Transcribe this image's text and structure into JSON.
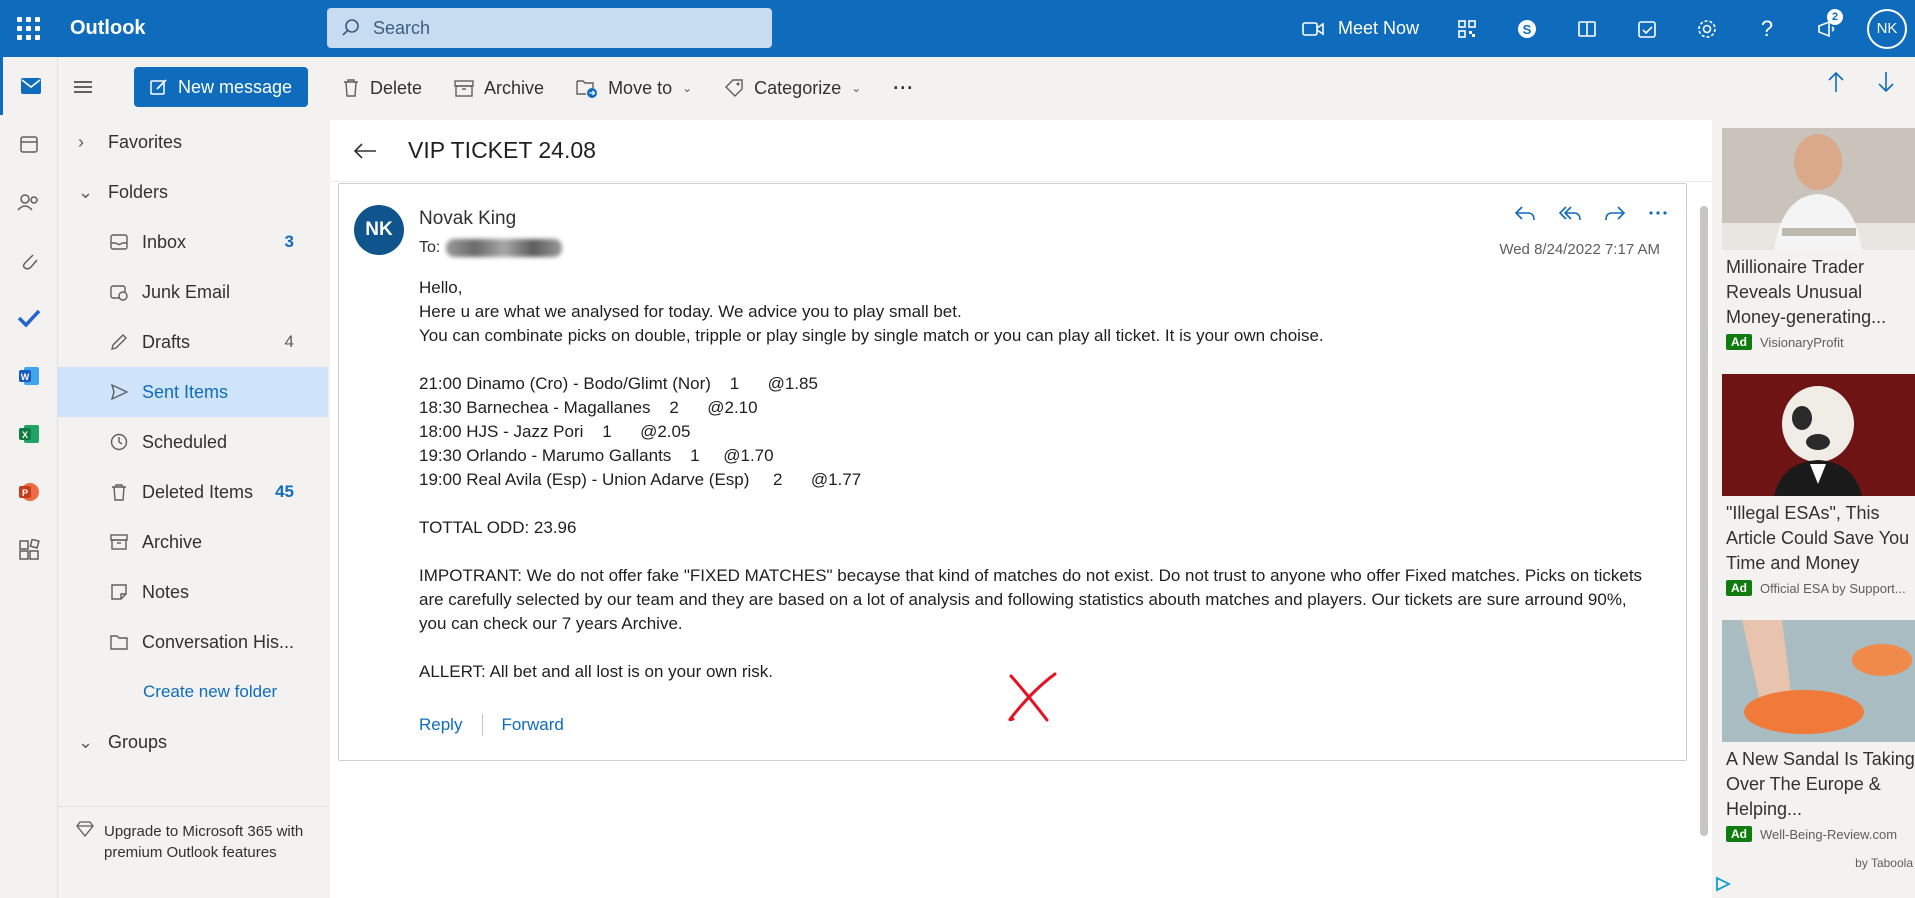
{
  "app": {
    "name": "Outlook"
  },
  "search": {
    "placeholder": "Search"
  },
  "topbar": {
    "meet_now": "Meet Now",
    "notifications_count": "2",
    "user_initials": "NK"
  },
  "toolbar": {
    "new_message": "New message",
    "delete": "Delete",
    "archive": "Archive",
    "move_to": "Move to",
    "categorize": "Categorize",
    "more": "···"
  },
  "folders": {
    "favorites": "Favorites",
    "folders_header": "Folders",
    "items": [
      {
        "label": "Inbox",
        "count": "3"
      },
      {
        "label": "Junk Email",
        "count": ""
      },
      {
        "label": "Drafts",
        "count": "4"
      },
      {
        "label": "Sent Items",
        "count": ""
      },
      {
        "label": "Scheduled",
        "count": ""
      },
      {
        "label": "Deleted Items",
        "count": "45"
      },
      {
        "label": "Archive",
        "count": ""
      },
      {
        "label": "Notes",
        "count": ""
      },
      {
        "label": "Conversation His...",
        "count": ""
      }
    ],
    "create_new": "Create new folder",
    "groups": "Groups",
    "upgrade_text": "Upgrade to Microsoft 365 with premium Outlook features"
  },
  "message": {
    "subject": "VIP TICKET 24.08",
    "sender_initials": "NK",
    "sender": "Novak King",
    "to_label": "To:",
    "date": "Wed 8/24/2022 7:17 AM",
    "greeting": "Hello,",
    "line1": "Here u are what we analysed for today. We advice you to play small bet.",
    "line2": "You can combinate picks on double, tripple or play single by single match or you can play all ticket. It is your own choise.",
    "picks": [
      "21:00 Dinamo (Cro) - Bodo/Glimt (Nor)    1      @1.85",
      "18:30 Barnechea - Magallanes    2      @2.10",
      "18:00 HJS - Jazz Pori    1      @2.05",
      "19:30 Orlando - Marumo Gallants    1     @1.70",
      "19:00 Real Avila (Esp) - Union Adarve (Esp)     2      @1.77"
    ],
    "total": "TOTTAL ODD: 23.96",
    "important": "IMPOTRANT: We do not offer fake \"FIXED MATCHES\" becayse that kind of matches do not exist. Do not trust to anyone who offer Fixed matches. Picks on tickets are carefully selected by our team and they are based on a lot of analysis and following statistics abouth matches and players. Our tickets are sure arround 90%, you can check our 7 years Archive.",
    "alert": "ALLERT: All bet and all lost is on your own risk.",
    "reply": "Reply",
    "forward": "Forward"
  },
  "ads": [
    {
      "title": "Millionaire Trader Reveals Unusual Money-generating...",
      "tag": "Ad",
      "source": "VisionaryProfit"
    },
    {
      "title": "\"Illegal ESAs\", This Article Could Save You Time and Money",
      "tag": "Ad",
      "source": "Official ESA by Support..."
    },
    {
      "title": "A New Sandal Is Taking Over The Europe & Helping...",
      "tag": "Ad",
      "source": "Well-Being-Review.com"
    }
  ],
  "ads_footer": "by Taboola"
}
